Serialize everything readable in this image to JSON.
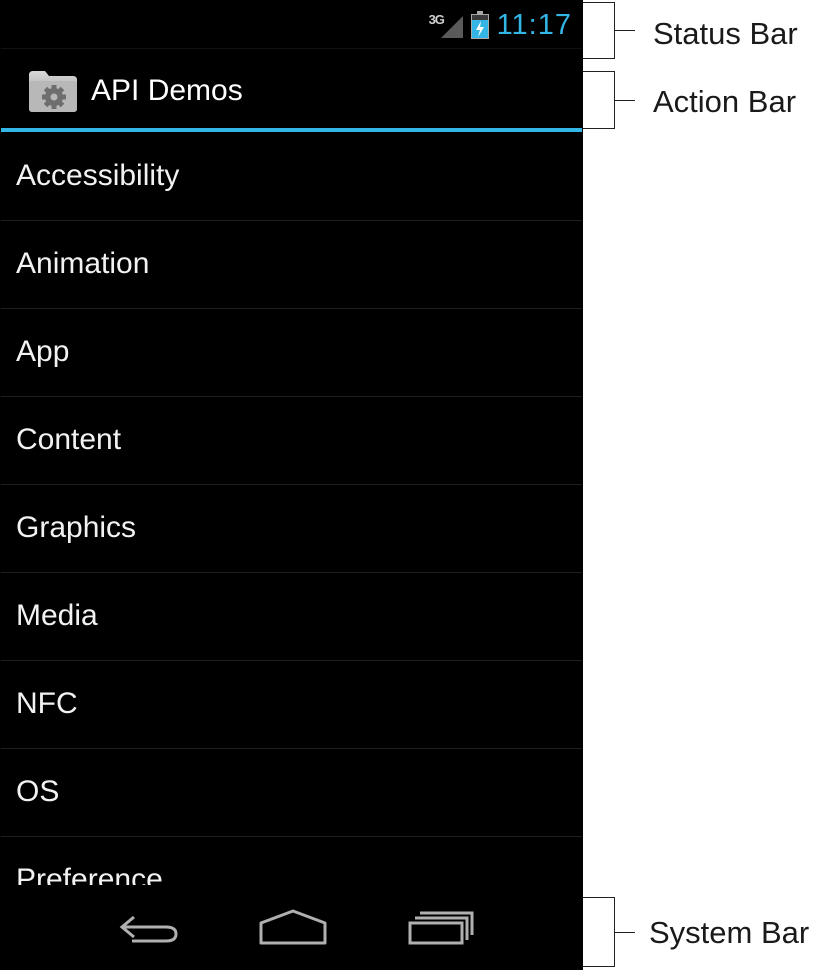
{
  "status_bar": {
    "network_label": "3G",
    "time": "11:17",
    "network_icon": "signal-icon",
    "battery_icon": "battery-charging-icon"
  },
  "action_bar": {
    "title": "API Demos",
    "icon": "folder-gear-icon"
  },
  "list": {
    "items": [
      {
        "label": "Accessibility"
      },
      {
        "label": "Animation"
      },
      {
        "label": "App"
      },
      {
        "label": "Content"
      },
      {
        "label": "Graphics"
      },
      {
        "label": "Media"
      },
      {
        "label": "NFC"
      },
      {
        "label": "OS"
      },
      {
        "label": "Preference"
      }
    ]
  },
  "system_bar": {
    "buttons": [
      "back-icon",
      "home-icon",
      "recent-apps-icon"
    ]
  },
  "callouts": {
    "status_bar": "Status Bar",
    "action_bar": "Action Bar",
    "system_bar": "System Bar"
  },
  "colors": {
    "accent": "#33b5e5",
    "background": "#000000",
    "text": "#ffffff"
  }
}
